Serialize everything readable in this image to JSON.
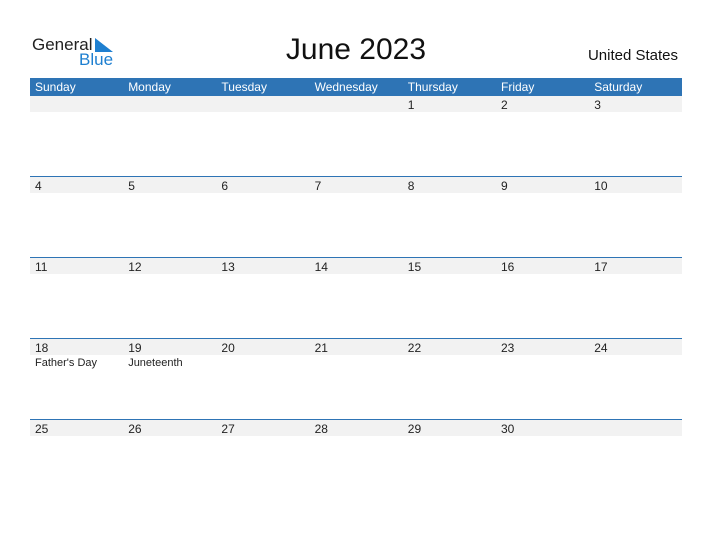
{
  "logo": {
    "line1": "General",
    "line2": "Blue"
  },
  "title": "June 2023",
  "country": "United States",
  "days": [
    "Sunday",
    "Monday",
    "Tuesday",
    "Wednesday",
    "Thursday",
    "Friday",
    "Saturday"
  ],
  "weeks": [
    [
      "",
      "",
      "",
      "",
      "1",
      "2",
      "3"
    ],
    [
      "4",
      "5",
      "6",
      "7",
      "8",
      "9",
      "10"
    ],
    [
      "11",
      "12",
      "13",
      "14",
      "15",
      "16",
      "17"
    ],
    [
      "18",
      "19",
      "20",
      "21",
      "22",
      "23",
      "24"
    ],
    [
      "25",
      "26",
      "27",
      "28",
      "29",
      "30",
      ""
    ]
  ],
  "holidays": [
    {
      "week": 3,
      "col": 0,
      "name": "Father's Day"
    },
    {
      "week": 3,
      "col": 1,
      "name": "Juneteenth"
    }
  ],
  "colors": {
    "accent": "#2e74b5",
    "brand": "#1e7fd0",
    "strip": "#f2f2f2"
  }
}
